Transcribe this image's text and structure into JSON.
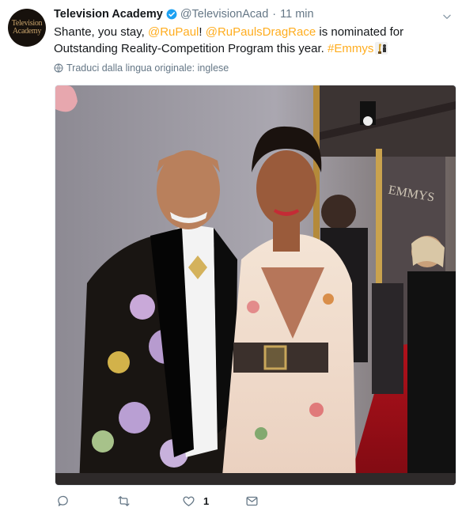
{
  "avatar": {
    "line1": "Television",
    "line2": "Academy"
  },
  "tweet": {
    "author_name": "Television Academy",
    "handle": "@TelevisionAcad",
    "separator": "·",
    "time": "11 min",
    "text_part1": "Shante, you stay, ",
    "mention1": "@RuPaul",
    "text_part2": "! ",
    "mention2": "@RuPaulsDragRace",
    "text_part3": " is nominated for Outstanding Reality-Competition Program this year. ",
    "hashtag": "#Emmys",
    "translate_label": "Traduci dalla lingua originale: inglese"
  },
  "photo": {
    "background_text": "EMMYS",
    "icon": "photo-image"
  },
  "actions": {
    "reply_icon": "reply-icon",
    "retweet_icon": "retweet-icon",
    "like_icon": "heart-icon",
    "like_count": "1",
    "dm_icon": "envelope-icon"
  },
  "colors": {
    "link": "#ffad1f",
    "muted": "#657786",
    "text": "#14171a",
    "verified": "#1da1f2"
  }
}
